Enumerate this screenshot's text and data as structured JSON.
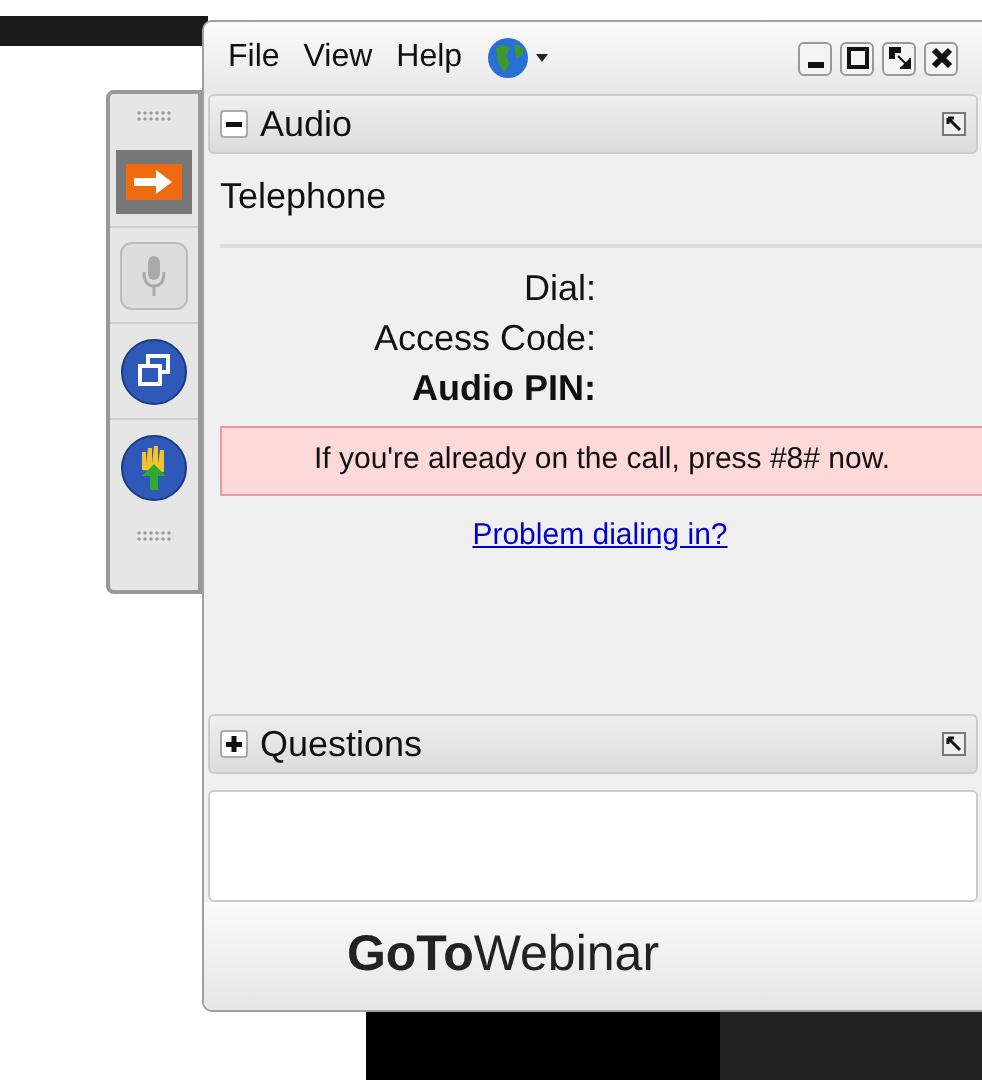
{
  "menu": [
    "File",
    "View",
    "Help"
  ],
  "toolbar": [
    {
      "kind": "arrow",
      "highlighted": true,
      "disabled": false
    },
    {
      "kind": "mic",
      "highlighted": false,
      "disabled": true
    },
    {
      "kind": "windows",
      "highlighted": false,
      "disabled": false
    },
    {
      "kind": "hand",
      "highlighted": false,
      "disabled": false
    }
  ],
  "audio": {
    "title": "Audio",
    "expanded": true,
    "mode": "Telephone",
    "fields": [
      {
        "label": "Dial:",
        "strong": false
      },
      {
        "label": "Access Code:",
        "strong": false
      },
      {
        "label": "Audio PIN:",
        "strong": true
      }
    ],
    "notice": "If you're already on the call, press #8# now.",
    "link": "Problem dialing in?"
  },
  "questions": {
    "title": "Questions",
    "expanded": false
  },
  "brand": "**GoTo**Webinar"
}
